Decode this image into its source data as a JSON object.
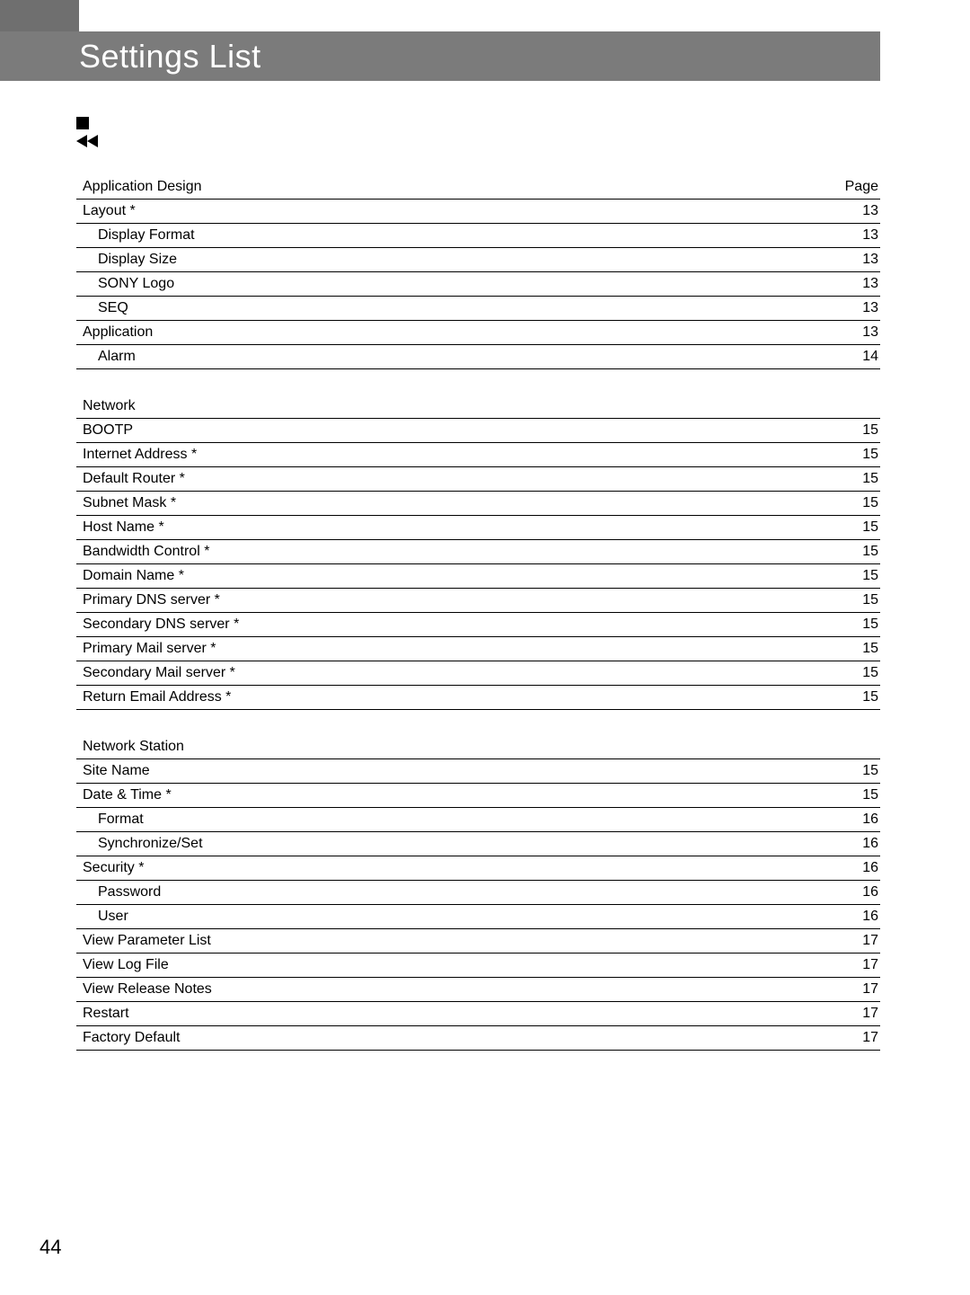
{
  "page_title": "Settings List",
  "page_col_label": "Page",
  "footer_page": "44",
  "sections": [
    {
      "header": "Application Design",
      "show_page_label": true,
      "rows": [
        {
          "label": "Layout *",
          "page": "13",
          "lvl": 0
        },
        {
          "label": "Display Format",
          "page": "13",
          "lvl": 1
        },
        {
          "label": "Display Size",
          "page": "13",
          "lvl": 1
        },
        {
          "label": "SONY Logo",
          "page": "13",
          "lvl": 1
        },
        {
          "label": "SEQ",
          "page": "13",
          "lvl": 1
        },
        {
          "label": "Application",
          "page": "13",
          "lvl": 0
        },
        {
          "label": "Alarm",
          "page": "14",
          "lvl": 1
        }
      ]
    },
    {
      "header": "Network",
      "show_page_label": false,
      "rows": [
        {
          "label": "BOOTP",
          "page": "15",
          "lvl": 0
        },
        {
          "label": "Internet Address *",
          "page": "15",
          "lvl": 0
        },
        {
          "label": "Default Router *",
          "page": "15",
          "lvl": 0
        },
        {
          "label": "Subnet Mask *",
          "page": "15",
          "lvl": 0
        },
        {
          "label": "Host Name *",
          "page": "15",
          "lvl": 0
        },
        {
          "label": "Bandwidth Control *",
          "page": "15",
          "lvl": 0
        },
        {
          "label": "Domain Name *",
          "page": "15",
          "lvl": 0
        },
        {
          "label": "Primary DNS server *",
          "page": "15",
          "lvl": 0
        },
        {
          "label": "Secondary DNS server *",
          "page": "15",
          "lvl": 0
        },
        {
          "label": "Primary Mail server *",
          "page": "15",
          "lvl": 0
        },
        {
          "label": "Secondary Mail server *",
          "page": "15",
          "lvl": 0
        },
        {
          "label": "Return Email Address *",
          "page": "15",
          "lvl": 0
        }
      ]
    },
    {
      "header": "Network Station",
      "show_page_label": false,
      "rows": [
        {
          "label": "Site Name",
          "page": "15",
          "lvl": 0
        },
        {
          "label": "Date & Time *",
          "page": "15",
          "lvl": 0
        },
        {
          "label": "Format",
          "page": "16",
          "lvl": 1
        },
        {
          "label": "Synchronize/Set",
          "page": "16",
          "lvl": 1
        },
        {
          "label": "Security *",
          "page": "16",
          "lvl": 0
        },
        {
          "label": "Password",
          "page": "16",
          "lvl": 1
        },
        {
          "label": "User",
          "page": "16",
          "lvl": 1
        },
        {
          "label": "View Parameter List",
          "page": "17",
          "lvl": 0
        },
        {
          "label": "View Log File",
          "page": "17",
          "lvl": 0
        },
        {
          "label": "View Release Notes",
          "page": "17",
          "lvl": 0
        },
        {
          "label": "Restart",
          "page": "17",
          "lvl": 0
        },
        {
          "label": "Factory Default",
          "page": "17",
          "lvl": 0
        }
      ]
    }
  ]
}
